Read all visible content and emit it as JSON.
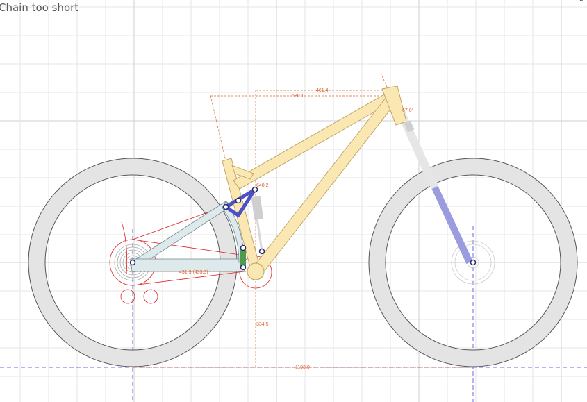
{
  "status": {
    "message": "Chain too short"
  },
  "dimensions": {
    "reach_top": "461.4",
    "stack_top": "630.1",
    "head_angle": "67.0°",
    "seat_len": "640.2",
    "chainstay": "431.9 (433.3)",
    "bb_drop": "334.5",
    "wheelbase": "1193.9"
  },
  "colors": {
    "frame": "#fbe7b2",
    "frame_stroke": "#b8a060",
    "swingarm": "#dde9ea",
    "link": "#4c4fc6",
    "shock": "#4f9a4f",
    "fork": "#9b9be0",
    "dim": "#e0602a",
    "chain": "#e02020"
  },
  "icons": [
    "chevron-down-icon"
  ]
}
